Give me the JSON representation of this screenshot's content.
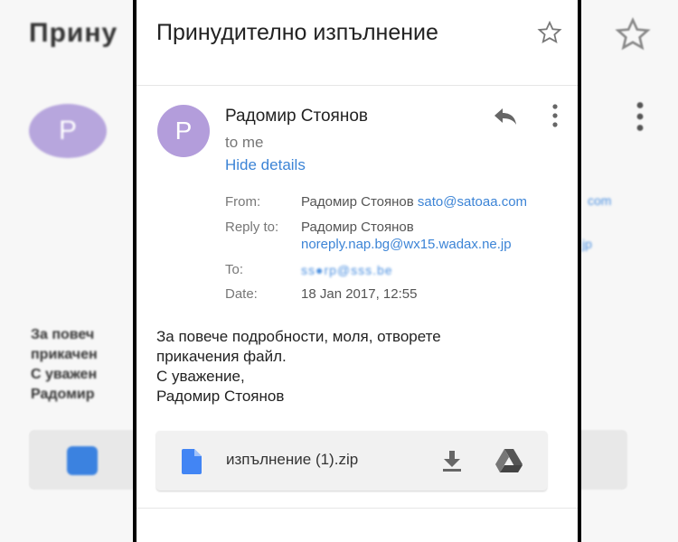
{
  "background": {
    "title": "Прину",
    "avatar_letter": "P",
    "link_fragment_1": "com",
    "link_fragment_2": "jp",
    "body_lines": "За повеч\nприкачен\nС уважен\nРадомир"
  },
  "email": {
    "subject": "Принудително изпълнение",
    "avatar_letter": "P",
    "sender_name": "Радомир Стоянов",
    "to_line": "to me",
    "hide_details": "Hide details",
    "from_label": "From:",
    "from_name": "Радомир Стоянов",
    "from_email": "sato@satoaa.com",
    "reply_to_label": "Reply to:",
    "reply_to_name": "Радомир Стоянов",
    "reply_to_email": "noreply.nap.bg@wx15.wadax.ne.jp",
    "to_label": "To:",
    "to_value_redacted": "ss●rp@sss.be",
    "date_label": "Date:",
    "date_value": "18 Jan 2017, 12:55",
    "body_line_1": "За повече подробности, моля, отворете",
    "body_line_2": "прикачения файл.",
    "body_line_3": "С уважение,",
    "body_line_4": "Радомир Стоянов"
  },
  "attachment": {
    "file_name": "изпълнение (1).zip",
    "file_icon": "file-icon",
    "download_icon": "download-icon",
    "drive_icon": "drive-icon"
  },
  "colors": {
    "accent": "#3c84d6",
    "avatar": "#b39ddb",
    "file_icon": "#4285f4"
  }
}
